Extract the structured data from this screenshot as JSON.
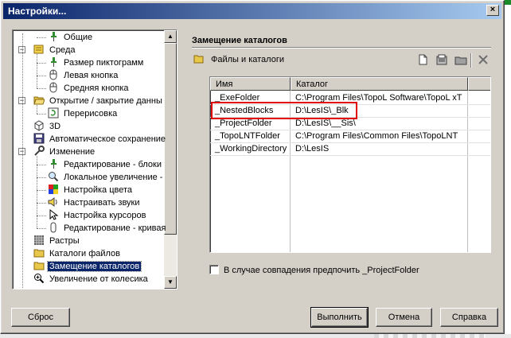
{
  "window": {
    "title": "Настройки...",
    "close_glyph": "×"
  },
  "tree": {
    "items": [
      {
        "label": "Общие",
        "icon": "pin-icon",
        "level": 2
      },
      {
        "label": "Среда",
        "icon": "environment-icon",
        "level": 1,
        "expander": "−"
      },
      {
        "label": "Размер пиктограмм",
        "icon": "pin-icon",
        "level": 2
      },
      {
        "label": "Левая кнопка",
        "icon": "mouse-icon",
        "level": 2
      },
      {
        "label": "Средняя кнопка",
        "icon": "mouse-icon",
        "level": 2
      },
      {
        "label": "Открытие / закрытие данны",
        "icon": "open-folder-icon",
        "level": 1,
        "expander": "−"
      },
      {
        "label": "Перерисовка",
        "icon": "redraw-icon",
        "level": 2
      },
      {
        "label": "3D",
        "icon": "cube-icon",
        "level": 1
      },
      {
        "label": "Автоматическое сохранение",
        "icon": "save-icon",
        "level": 1
      },
      {
        "label": "Изменение",
        "icon": "wrench-icon",
        "level": 1,
        "expander": "−"
      },
      {
        "label": "Редактирование - блоки",
        "icon": "pin-icon",
        "level": 2
      },
      {
        "label": "Локальное увеличение -",
        "icon": "magnifier-icon",
        "level": 2
      },
      {
        "label": "Настройка цвета",
        "icon": "color-palette-icon",
        "level": 2
      },
      {
        "label": "Настраивать звуки",
        "icon": "speaker-icon",
        "level": 2
      },
      {
        "label": "Настройка курсоров",
        "icon": "cursor-icon",
        "level": 2
      },
      {
        "label": "Редактирование - кривая",
        "icon": "curve-icon",
        "level": 2
      },
      {
        "label": "Растры",
        "icon": "raster-icon",
        "level": 1
      },
      {
        "label": "Каталоги файлов",
        "icon": "folder-icon",
        "level": 1
      },
      {
        "label": "Замещение каталогов",
        "icon": "folder-icon",
        "level": 1,
        "selected": true
      },
      {
        "label": "Увеличение от колесика",
        "icon": "zoom-icon",
        "level": 1
      }
    ]
  },
  "section": {
    "title": "Замещение каталогов",
    "subtitle": "Файлы и каталоги"
  },
  "grid": {
    "columns": [
      "Имя",
      "Каталог"
    ],
    "rows": [
      {
        "name": "_ExeFolder",
        "path": "C:\\Program Files\\TopoL Software\\TopoL xT"
      },
      {
        "name": "_NestedBlocks",
        "path": "D:\\LesIS\\_Blk"
      },
      {
        "name": "_ProjectFolder",
        "path": "D:\\LesIS\\__Sis\\"
      },
      {
        "name": "_TopoLNTFolder",
        "path": "C:\\Program Files\\Common Files\\TopoLNT"
      },
      {
        "name": "_WorkingDirectory",
        "path": "D:\\LesIS"
      }
    ],
    "highlighted_row": "_NestedBlocks"
  },
  "checkbox": {
    "label": "В случае совпадения предпочить _ProjectFolder",
    "checked": false
  },
  "buttons": {
    "reset": "Сброс",
    "apply": "Выполнить",
    "cancel": "Отмена",
    "help": "Справка"
  },
  "colors": {
    "selection": "#0a246a",
    "highlight_border": "#e00000",
    "title_bar": "#0a246a"
  }
}
